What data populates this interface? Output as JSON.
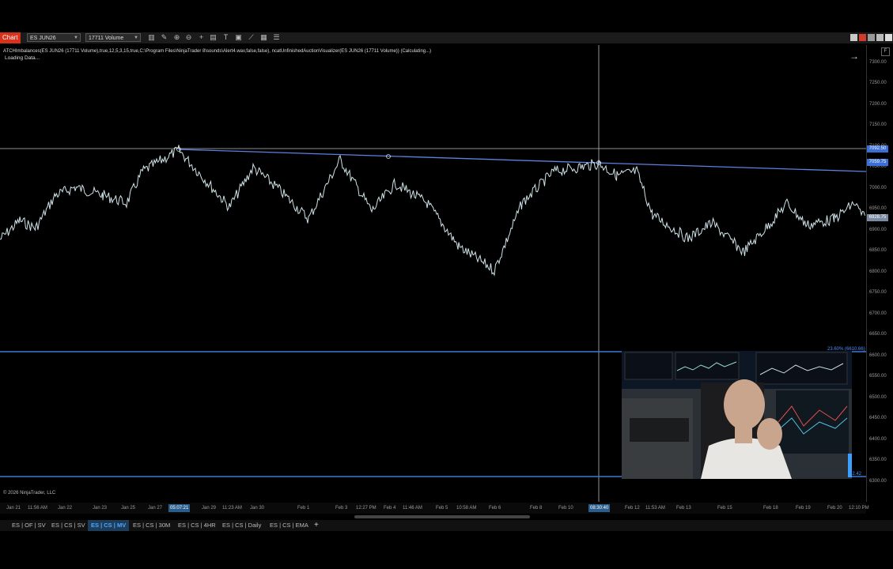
{
  "toolbar": {
    "chart_tag": "Chart",
    "instrument": "ES JUN26",
    "bar_type": "17711 Volume"
  },
  "chart": {
    "indicator_text": "ATCHImbalances(ES JUN26 (17711 Volume),true,12,5,3,15,true,C:\\Program Files\\NinjaTrader 8\\sounds\\Alert4.wav,false,false), ncatUnfinishedAuctionVisualizer(ES JUN26 (17711 Volume)) (Calculating...)",
    "loading": "Loading Data...",
    "copyright": "© 2026 NinjaTrader, LLC",
    "y_labels": [
      "7300.00",
      "7250.00",
      "7200.00",
      "7150.00",
      "7100.00",
      "7050.00",
      "7000.00",
      "6950.00",
      "6900.00",
      "6850.00",
      "6800.00",
      "6750.00",
      "6700.00",
      "6650.00",
      "6600.00",
      "6550.00",
      "6500.00",
      "6450.00",
      "6400.00",
      "6350.00",
      "6300.00"
    ],
    "tags": {
      "crosshair": "7092.50",
      "trendline": "7059.75",
      "last": "6928.75"
    },
    "fib_label": "23.60% (6610.66)",
    "fib_label2": "12.42",
    "x_labels": [
      "Jan 21",
      "11:56 AM",
      "Jan 22",
      "Jan 23",
      "Jan 25",
      "Jan 27",
      "Jan 29",
      "11:23 AM",
      "Jan 30",
      "Feb 1",
      "Feb 3",
      "12:27 PM",
      "Feb 4",
      "11:46 AM",
      "Feb 5",
      "10:58 AM",
      "Feb 6",
      "Feb 8",
      "Feb 10",
      "Feb 12",
      "11:53 AM",
      "Feb 13",
      "Feb 15",
      "Feb 18",
      "Feb 19",
      "Feb 20",
      "12:10 PM"
    ],
    "x_highlight_1": "05:07:21",
    "x_highlight_2": "08:30:40",
    "colors": {
      "price_line": "#cfe3e8",
      "trendline": "#5b82e0",
      "fib_line": "#3a7bd5",
      "crosshair": "#bbbbbb",
      "tag_blue": "#3b6fd6",
      "tag_last": "#7a8aa3"
    }
  },
  "tabs": [
    {
      "label": "ES | OF | SV",
      "active": false
    },
    {
      "label": "ES | CS | SV",
      "active": false
    },
    {
      "label": "ES | CS | MV",
      "active": true
    },
    {
      "label": "ES | CS | 30M",
      "active": false
    },
    {
      "label": "ES | CS | 4HR",
      "active": false
    },
    {
      "label": "ES | CS | Daily",
      "active": false
    },
    {
      "label": "ES | CS | EMA",
      "active": false
    }
  ],
  "tab_plus": "+"
}
